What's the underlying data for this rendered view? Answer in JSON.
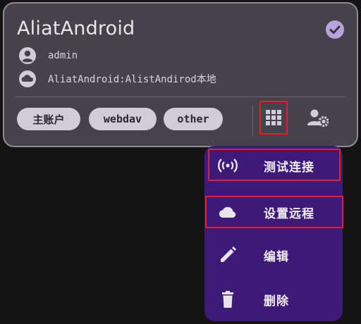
{
  "account": {
    "title": "AliatAndroid",
    "username": "admin",
    "remote": "AliatAndroid:AlistAndirod本地",
    "checked": true
  },
  "chips": [
    "主账户",
    "webdav",
    "other"
  ],
  "menu": {
    "items": [
      {
        "label": "测试连接",
        "icon": "wifi-tethering-icon"
      },
      {
        "label": "设置远程",
        "icon": "cloud-icon"
      },
      {
        "label": "编辑",
        "icon": "pencil-icon"
      },
      {
        "label": "删除",
        "icon": "trash-icon"
      }
    ]
  },
  "colors": {
    "card": "#46424b",
    "menu": "#3d1a78",
    "chip": "#d2ccd6",
    "check": "#b7a4dc",
    "highlight": "#e0202a"
  }
}
